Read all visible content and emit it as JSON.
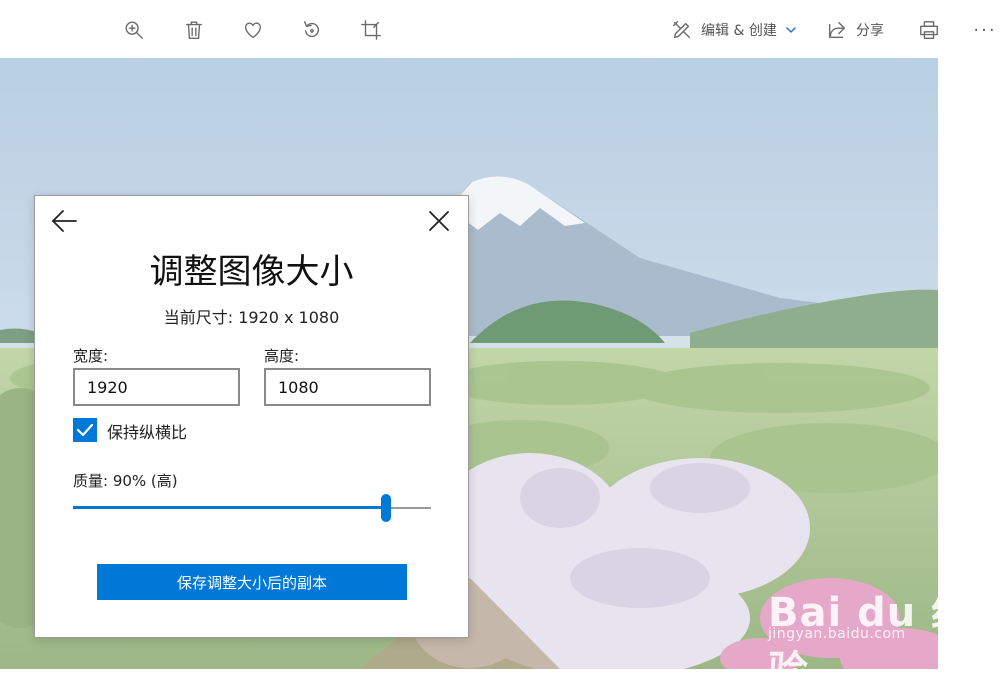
{
  "toolbar": {
    "edit_create_label": "编辑 & 创建",
    "share_label": "分享",
    "more_label": "···",
    "icons": [
      "zoom-in-icon",
      "delete-icon",
      "favorite-icon",
      "rotate-icon",
      "crop-icon",
      "edit-create-icon",
      "share-icon",
      "print-icon"
    ]
  },
  "dialog": {
    "title": "调整图像大小",
    "current_size": "当前尺寸: 1920 x 1080",
    "width_label": "宽度:",
    "width_value": "1920",
    "height_label": "高度:",
    "height_value": "1080",
    "keep_ratio_label": "保持纵横比",
    "keep_ratio_checked": true,
    "quality_label": "质量: 90% (高)",
    "quality_value": 0.9,
    "save_button": "保存调整大小后的副本"
  },
  "watermark": {
    "logo": "Bai du 经验",
    "url": "jingyan.baidu.com"
  },
  "colors": {
    "accent": "#0078d7",
    "toolbar_icon": "#6a6a6a",
    "chevron": "#2b6fc7"
  }
}
